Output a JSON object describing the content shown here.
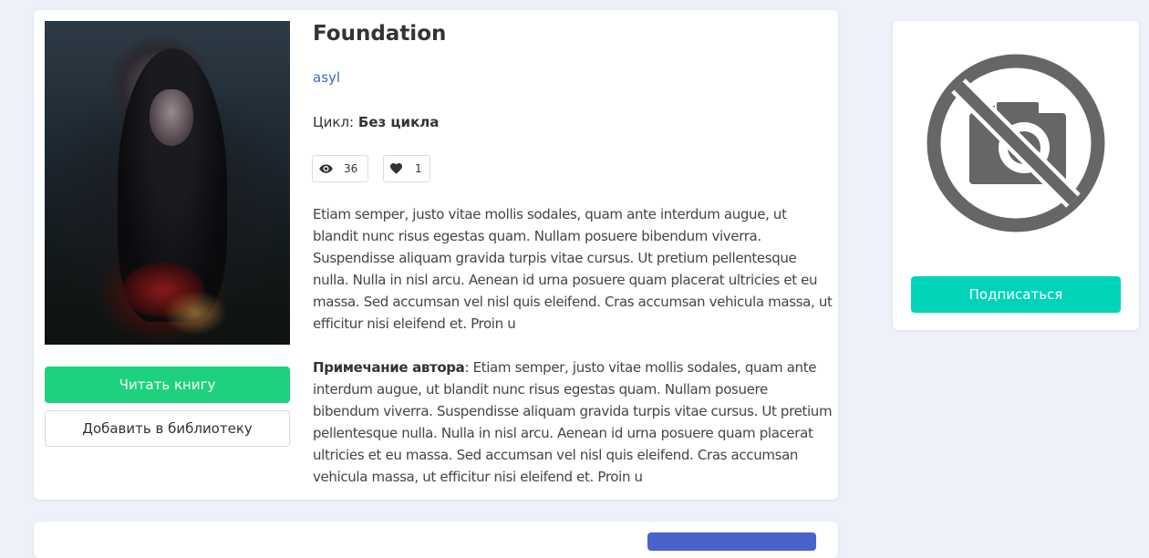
{
  "book": {
    "title": "Foundation",
    "author": "asyl",
    "cycle_label": "Цикл:",
    "cycle_value": "Без цикла",
    "views": "36",
    "likes": "1",
    "description": "Etiam semper, justo vitae mollis sodales, quam ante interdum augue, ut blandit nunc risus egestas quam. Nullam posuere bibendum viverra. Suspendisse aliquam gravida turpis vitae cursus. Ut pretium pellentesque nulla. Nulla in nisl arcu. Aenean id urna posuere quam placerat ultricies et eu massa. Sed accumsan vel nisl quis eleifend. Cras accumsan vehicula massa, ut efficitur nisi eleifend et. Proin u",
    "note_label": "Примечание автора",
    "note_text": ": Etiam semper, justo vitae mollis sodales, quam ante interdum augue, ut blandit nunc risus egestas quam. Nullam posuere bibendum viverra. Suspendisse aliquam gravida turpis vitae cursus. Ut pretium pellentesque nulla. Nulla in nisl arcu. Aenean id urna posuere quam placerat ultricies et eu massa. Sed accumsan vel nisl quis eleifend. Cras accumsan vehicula massa, ut efficitur nisi eleifend et. Proin u"
  },
  "actions": {
    "read_label": "Читать книгу",
    "library_label": "Добавить в библиотеку"
  },
  "author_card": {
    "subscribe_label": "Подписаться"
  },
  "icons": {
    "views": "eye-icon",
    "likes": "heart-icon",
    "no_photo": "no-photo-icon"
  },
  "colors": {
    "read_button": "#1ed17e",
    "subscribe_button": "#00d4b8",
    "link": "#3f6ab8",
    "page_background": "#eef1f9"
  }
}
